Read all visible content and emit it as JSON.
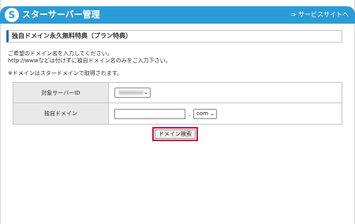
{
  "header": {
    "logo_letter": "S",
    "title": "スターサーバー管理",
    "service_link_arrow": "⇒",
    "service_link": "サービスサイトへ"
  },
  "section": {
    "title": "独自ドメイン永久無料特典（プラン特典）"
  },
  "description": {
    "line1": "ご希望のドメイン名を入力してください。",
    "line2": "http://wwwなどは付けずに独自ドメイン名のみをご入力下さい。",
    "note": "※ドメインはスタードメインで取得されます。"
  },
  "form": {
    "server_id_label": "対象サーバーID",
    "domain_label": "独自ドメイン",
    "domain_value": "",
    "tld_separator": ".",
    "tld_selected": "com",
    "caret": "⌄"
  },
  "actions": {
    "search_label": "ドメイン検索"
  },
  "colors": {
    "header": "#2b9bd6",
    "highlight": "#d0144b"
  }
}
